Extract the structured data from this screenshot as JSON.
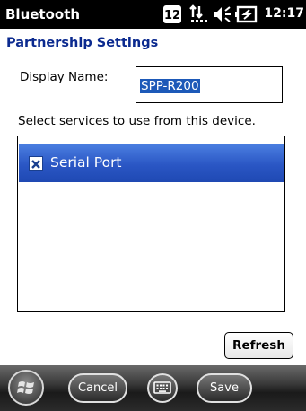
{
  "title_bar": {
    "app_title": "Bluetooth",
    "time": "12:17",
    "icons": [
      "calendar-12-icon",
      "network-arrows-icon",
      "volume-icon",
      "battery-charging-icon"
    ],
    "calendar_day": "12"
  },
  "page": {
    "subtitle": "Partnership Settings",
    "subtitle_color": "#0b2a8f"
  },
  "form": {
    "display_name_label": "Display Name:",
    "display_name_value": "SPP-R200",
    "services_label": "Select services to use from this device.",
    "services": [
      {
        "label": "Serial Port",
        "checked": true,
        "selected": true
      }
    ],
    "refresh_label": "Refresh"
  },
  "softkeys": {
    "cancel_label": "Cancel",
    "save_label": "Save"
  },
  "colors": {
    "selection": "#1d59b8",
    "list_highlight": "#2a56c4"
  }
}
